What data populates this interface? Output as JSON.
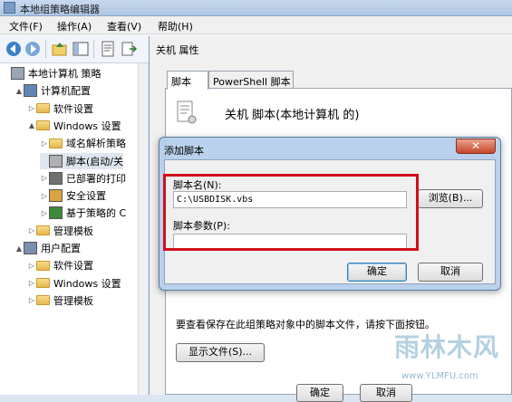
{
  "window": {
    "title": "本地组策略编辑器"
  },
  "menu": [
    "文件(F)",
    "操作(A)",
    "查看(V)",
    "帮助(H)"
  ],
  "tree": [
    {
      "label": "本地计算机 策略",
      "level": 0,
      "arrow": ""
    },
    {
      "label": "计算机配置",
      "level": 1,
      "arrow": "▲"
    },
    {
      "label": "软件设置",
      "level": 2,
      "arrow": "▷"
    },
    {
      "label": "Windows 设置",
      "level": 2,
      "arrow": "▲"
    },
    {
      "label": "域名解析策略",
      "level": 3,
      "arrow": "▷"
    },
    {
      "label": "脚本(启动/关",
      "level": 3,
      "arrow": ""
    },
    {
      "label": "已部署的打印",
      "level": 3,
      "arrow": "▷"
    },
    {
      "label": "安全设置",
      "level": 3,
      "arrow": "▷"
    },
    {
      "label": "基于策略的 C",
      "level": 3,
      "arrow": "▷"
    },
    {
      "label": "管理模板",
      "level": 2,
      "arrow": "▷"
    },
    {
      "label": "用户配置",
      "level": 1,
      "arrow": "▲"
    },
    {
      "label": "软件设置",
      "level": 2,
      "arrow": "▷"
    },
    {
      "label": "Windows 设置",
      "level": 2,
      "arrow": "▷"
    },
    {
      "label": "管理模板",
      "level": 2,
      "arrow": "▷"
    }
  ],
  "properties": {
    "title": "关机 属性",
    "tabs": [
      "脚本",
      "PowerShell 脚本"
    ],
    "script_header": "关机 脚本(本地计算机 的)",
    "hint": "要查看保存在此组策略对象中的脚本文件，请按下面按钮。",
    "show_files": "显示文件(S)...",
    "ok": "确定",
    "cancel": "取消"
  },
  "dialog": {
    "title": "添加脚本",
    "close": "✕",
    "script_name_label": "脚本名(N):",
    "script_name_value": "C:\\USBDISK.vbs",
    "browse": "浏览(B)...",
    "params_label": "脚本参数(P):",
    "params_value": "",
    "ok": "确定",
    "cancel": "取消"
  },
  "watermark": {
    "text": "雨林木风",
    "url": "www.YLMFU.com"
  },
  "colors": {
    "highlight": "#d1101b",
    "dialog_frame": "#b4cdeb"
  }
}
